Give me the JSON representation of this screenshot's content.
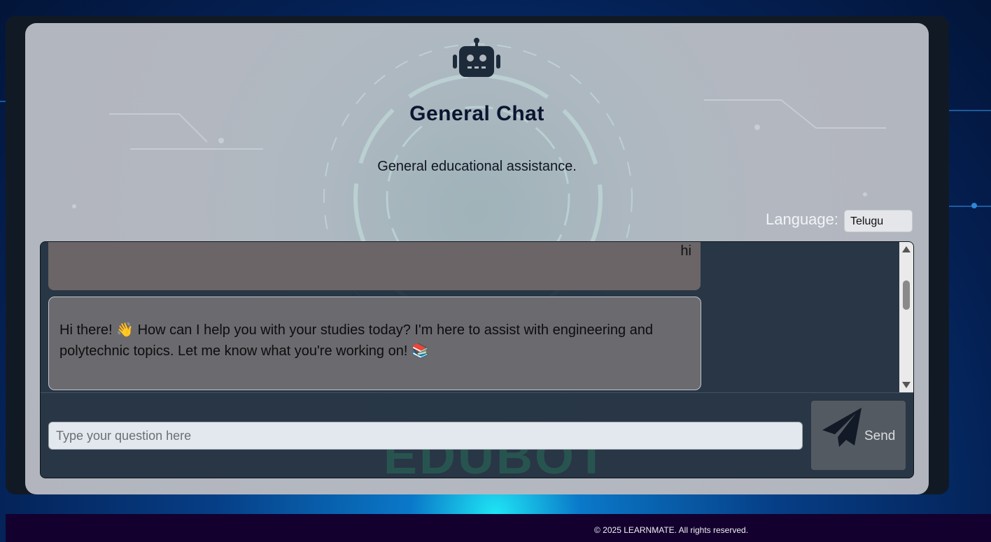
{
  "header": {
    "icon": "robot-icon",
    "title": "General Chat",
    "subtitle": "General educational assistance."
  },
  "language": {
    "label": "Language:",
    "selected": "Telugu"
  },
  "messages": [
    {
      "role": "user",
      "text": "hi"
    },
    {
      "role": "bot",
      "text": "Hi there! 👋 How can I help you with your studies today? I'm here to assist with engineering and polytechnic topics. Let me know what you're working on! 📚"
    }
  ],
  "input": {
    "placeholder": "Type your question here",
    "value": "",
    "watermark": "EDUBOT"
  },
  "send_button": {
    "label": "Send",
    "icon": "paper-plane-icon"
  },
  "footer": {
    "text": "© 2025 LEARNMATE. All rights reserved."
  },
  "colors": {
    "footer_bg": "#13002f",
    "title": "#0b1530",
    "chat_bg": "#1a2a3a"
  }
}
